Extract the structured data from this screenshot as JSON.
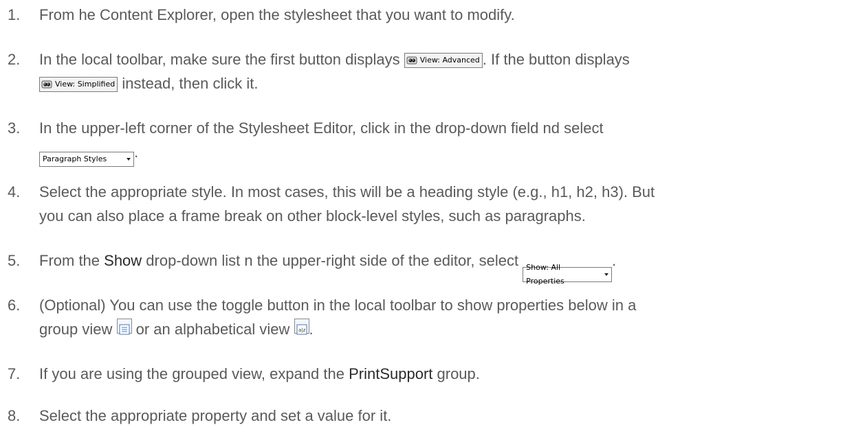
{
  "steps": [
    {
      "number": "1.",
      "text": "From  he Content Explorer, open the stylesheet that you want to modify."
    },
    {
      "number": "2.",
      "pre": "In the local toolbar, make sure the first button displays ",
      "btn_advanced": "View: Advanced",
      "mid": ". If the button displays",
      "btn_simplified": "View: Simplified",
      "post": " instead, then click it."
    },
    {
      "number": "3.",
      "pre": "In the upper-left corner of the Stylesheet Editor, click in the drop-down field  nd select",
      "select": "Paragraph Styles",
      "post": "."
    },
    {
      "number": "4.",
      "line1": "Select the appropriate style. In most cases, this will be a heading style (e.g., h1, h2, h3). But",
      "line2": "you can also place a frame break on other block-level styles, such as paragraphs."
    },
    {
      "number": "5.",
      "pre": "From the ",
      "strong": "Show",
      "mid": " drop-down list  n the upper-right side of the editor, select ",
      "select": "Show: All Properties",
      "post": "."
    },
    {
      "number": "6.",
      "line1": "(Optional) You can use the toggle button in the local toolbar to show properties below in a",
      "pre2": "group view ",
      "mid2": " or an alphabetical view ",
      "post2": "."
    },
    {
      "number": "7.",
      "pre": "If you are using the grouped view, expand the ",
      "strong": "PrintSupport",
      "post": " group."
    },
    {
      "number": "8.",
      "text": "Select the appropriate property and set a value for it."
    }
  ],
  "icons": {
    "view_button": "eye-icon",
    "group_view": "group-view-icon",
    "alpha_view": "alphabetical-view-icon"
  },
  "colors": {
    "text": "#5a5a5a",
    "strong": "#2b2b2b"
  }
}
